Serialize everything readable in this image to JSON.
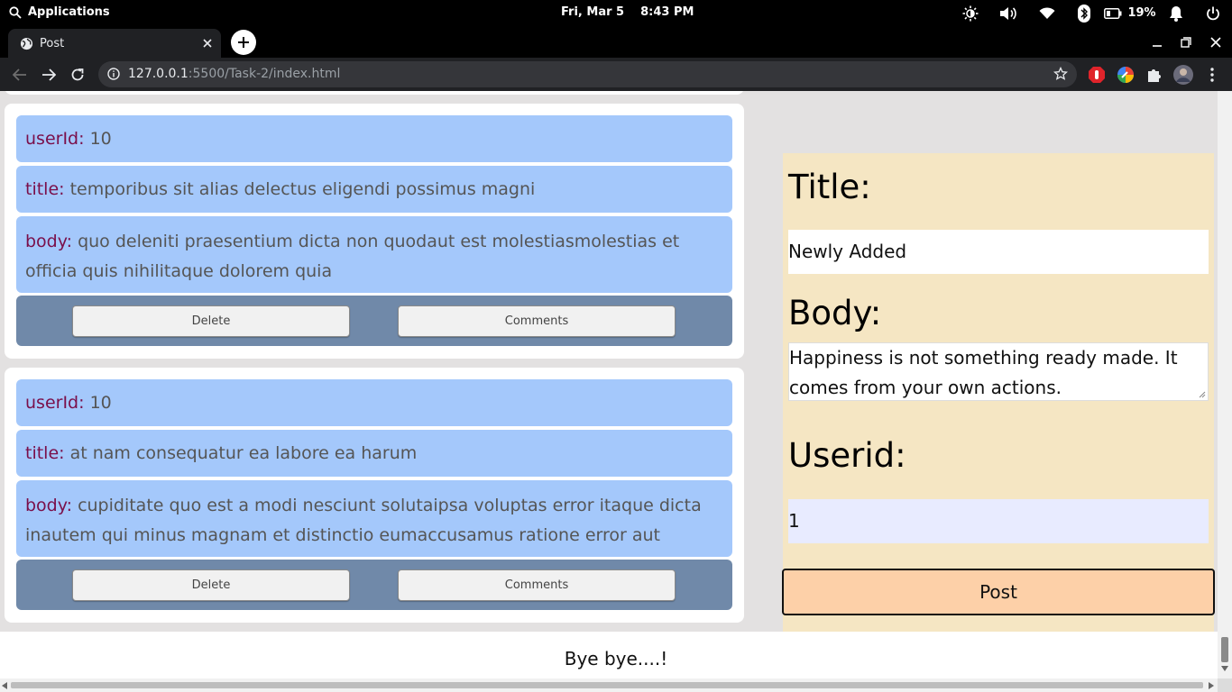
{
  "os": {
    "apps_label": "Applications",
    "date": "Fri, Mar 5",
    "time": "8:43 PM",
    "battery": "19%"
  },
  "browser": {
    "tab_title": "Post",
    "url_host": "127.0.0.1",
    "url_rest": ":5500/Task-2/index.html"
  },
  "posts": [
    {
      "userId_key": "userId:",
      "userId": "10",
      "title_key": "title:",
      "title": "temporibus sit alias delectus eligendi possimus magni",
      "body_key": "body:",
      "body": "quo deleniti praesentium dicta non quodaut est molestiasmolestias et officia quis nihilitaque dolorem quia",
      "delete_label": "Delete",
      "comments_label": "Comments"
    },
    {
      "userId_key": "userId:",
      "userId": "10",
      "title_key": "title:",
      "title": "at nam consequatur ea labore ea harum",
      "body_key": "body:",
      "body": "cupiditate quo est a modi nesciunt solutaipsa voluptas error itaque dicta inautem qui minus magnam et distinctio eumaccusamus ratione error aut",
      "delete_label": "Delete",
      "comments_label": "Comments"
    }
  ],
  "form": {
    "title_label": "Title:",
    "title_value": "Newly Added",
    "body_label": "Body:",
    "body_value": "Happiness is not something ready made. It comes from your own actions.",
    "userid_label": "Userid:",
    "userid_value": "1",
    "post_label": "Post"
  },
  "footer": {
    "text": "Bye bye....!"
  },
  "colors": {
    "field_bg": "#a4c8fb",
    "key_text": "#7a0f4a",
    "actions_bg": "#7089a9",
    "form_bg": "#f5e6c3",
    "post_button": "#fdd0a8"
  }
}
